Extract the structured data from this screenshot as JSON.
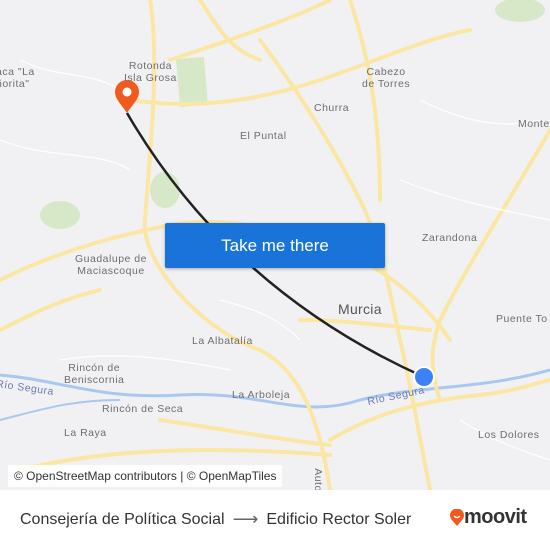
{
  "map": {
    "labels": [
      "Rotonda\nIsla Grosa",
      "aca \"La\nñorita\"",
      "Cabezo\nde Torres",
      "Churra",
      "El Puntal",
      "Monte",
      "Zarandona",
      "Guadalupe de\nMaciascoque",
      "Murcia",
      "Puente To",
      "La Albatalía",
      "Rincón de\nBeniscornia",
      "Río Segura",
      "Río Segura",
      "Rincón de Seca",
      "La Arboleja",
      "La Raya",
      "Los Dolores",
      "Auto"
    ],
    "attribution": "© OpenStreetMap contributors | © OpenMapTiles",
    "colors": {
      "road": "#fbe9a6",
      "route": "#222222",
      "origin_pin": "#f05a1e",
      "destination": "#3b82f6",
      "water": "#a9c8ef",
      "park": "#d4e6c5"
    }
  },
  "cta": {
    "label": "Take me there"
  },
  "footer": {
    "origin": "Consejería de Política Social",
    "arrow": "⟶",
    "destination": "Edificio Rector Soler",
    "brand": "moovit"
  }
}
